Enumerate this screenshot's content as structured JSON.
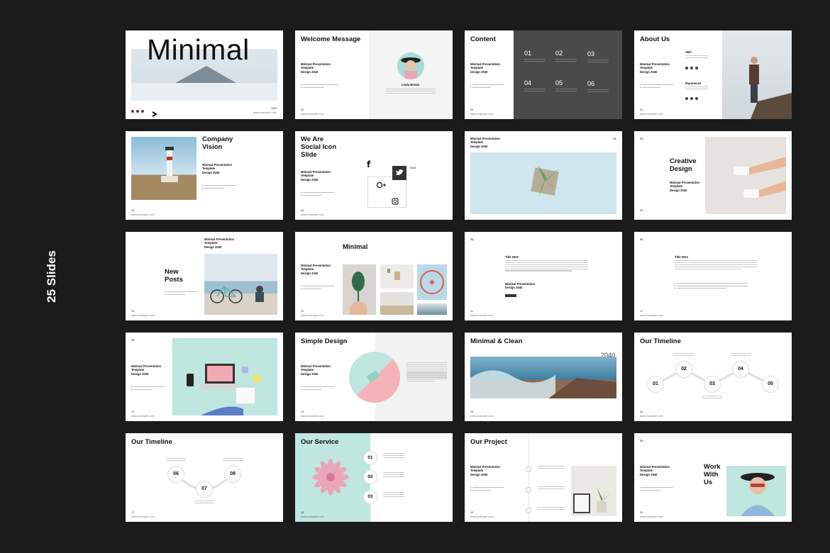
{
  "side_label": "25 Slides",
  "common": {
    "url": "www.example.com",
    "template_lines": [
      "Minimal Presentation",
      "Template",
      "Design 2040"
    ],
    "xl": "XL"
  },
  "s01": {
    "title": "Minimal",
    "year": "2040"
  },
  "s02": {
    "title": "Welcome Message",
    "num": "02",
    "person": "Linda Brown"
  },
  "s03": {
    "title": "Content",
    "num": "03",
    "items": [
      "01",
      "02",
      "03",
      "04",
      "05",
      "06"
    ]
  },
  "s04": {
    "title": "About Us",
    "num": "04",
    "skill": "Skill",
    "experience": "Experience"
  },
  "s05": {
    "title": "Company Vision",
    "num": "05"
  },
  "s06": {
    "title": "We Are Social Icon Slide",
    "num": "06",
    "icon_label": "Icon"
  },
  "s07": {},
  "s08": {
    "title": "Creative Design",
    "num": "08"
  },
  "s09": {
    "title": "New Posts",
    "num": "09"
  },
  "s10": {
    "title": "Minimal",
    "num": "10"
  },
  "s11": {
    "heading": "Title Here",
    "num": "11"
  },
  "s12": {
    "heading": "Title Here",
    "num": "12"
  },
  "s13": {
    "num": "13"
  },
  "s14": {
    "title": "Simple Design",
    "num": "14"
  },
  "s15": {
    "title": "Minimal & Clean",
    "year": "2040",
    "num": "15"
  },
  "s16": {
    "title": "Our Timeline",
    "num": "16",
    "points": [
      "01",
      "02",
      "03",
      "04",
      "05"
    ]
  },
  "s17": {
    "title": "Our Timeline",
    "num": "17",
    "points": [
      "06",
      "07",
      "08"
    ]
  },
  "s18": {
    "title": "Our Service",
    "num": "18",
    "points": [
      "01",
      "02",
      "03"
    ]
  },
  "s19": {
    "title": "Our Project",
    "num": "19"
  },
  "s20": {
    "title": "Work With Us",
    "num": "20"
  },
  "colors": {
    "bg": "#1b1b1b",
    "mint": "#bfe6df",
    "sky": "#cfe6ee",
    "pink": "#f3b3b9",
    "dark": "#4a4a4a"
  }
}
